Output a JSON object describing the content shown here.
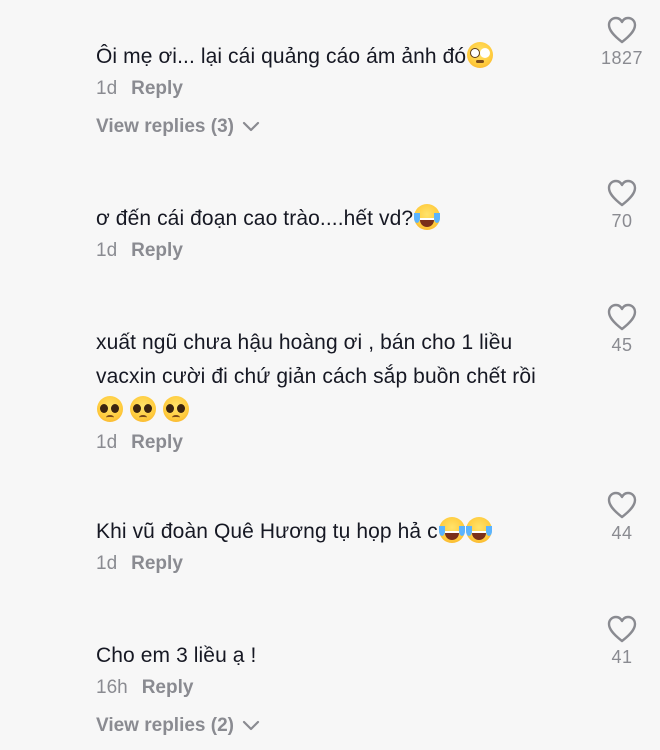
{
  "comments": [
    {
      "text": "Ôi mẹ ơi... lại cái quảng cáo ám ảnh đó",
      "emojis": [
        "flushed"
      ],
      "age": "1d",
      "reply_label": "Reply",
      "likes": "1827",
      "view_replies": "View replies (3)"
    },
    {
      "text": "ơ đến cái đoạn cao trào....hết vd?",
      "emojis": [
        "joy"
      ],
      "age": "1d",
      "reply_label": "Reply",
      "likes": "70"
    },
    {
      "text_line1": "xuất ngũ chưa hậu hoàng ơi , bán cho 1 liều",
      "text_line2": "vacxin cười đi chứ giản cách sắp buồn chết rồi",
      "emojis": [
        "pleading",
        "pleading",
        "pleading"
      ],
      "age": "1d",
      "reply_label": "Reply",
      "likes": "45"
    },
    {
      "text": "Khi vũ đoàn Quê Hương tụ họp hả c",
      "emojis": [
        "joy",
        "joy"
      ],
      "age": "1d",
      "reply_label": "Reply",
      "likes": "44"
    },
    {
      "text": "Cho em 3 liều ạ !",
      "emojis": [],
      "age": "16h",
      "reply_label": "Reply",
      "likes": "41",
      "view_replies": "View replies (2)"
    }
  ],
  "icons": {
    "like": "heart-outline-icon",
    "expand": "chevron-down-icon"
  },
  "colors": {
    "background": "#f7f7f7",
    "text": "#161823",
    "secondary": "#8a8b91"
  }
}
